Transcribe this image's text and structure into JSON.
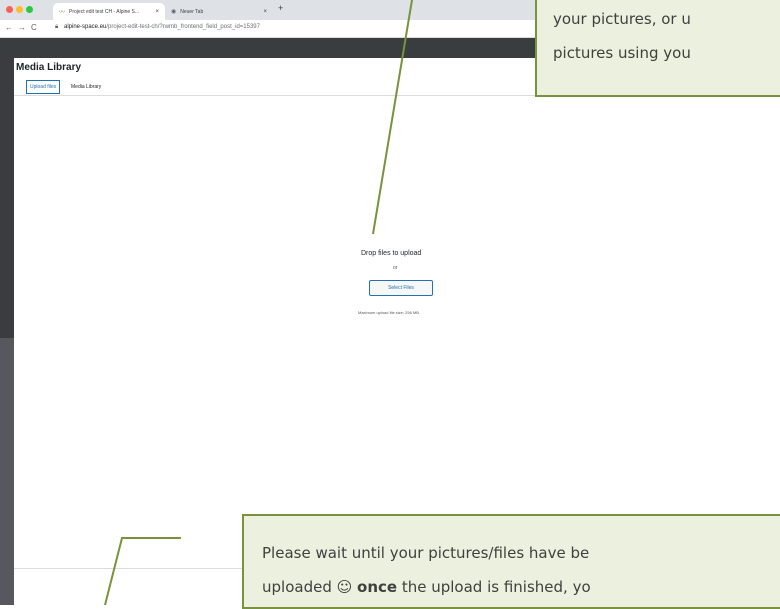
{
  "browser": {
    "tabs": [
      {
        "title": "Project edit test CH - Alpine S...",
        "close": "×"
      },
      {
        "title": "Neuer Tab",
        "close": "×"
      }
    ],
    "new_tab": "+",
    "nav": {
      "back": "←",
      "forward": "→",
      "reload": "C"
    },
    "url_host": "alpine-space.eu",
    "url_path": "/project-edit-test-ch/?rwmb_frontend_field_post_id=15397"
  },
  "modal": {
    "title": "Media Library",
    "tabs": [
      "Upload files",
      "Media Library"
    ],
    "drop_title": "Drop files to upload",
    "or_text": "or",
    "select_button": "Select Files",
    "max_size": "Maximum upload file size: 256 MB."
  },
  "callouts": {
    "top": {
      "line1": "your pictures, or u",
      "line2": "pictures using you"
    },
    "bottom": {
      "line1": "Please wait until your pictures/files have be",
      "line2_pre": "uploaded ☺ ",
      "line2_bold": "once",
      "line2_post": " the upload is finished, yo"
    }
  },
  "colors": {
    "callout_fill": "#ebf1de",
    "callout_border": "#77933c",
    "accent": "#2271b1"
  }
}
